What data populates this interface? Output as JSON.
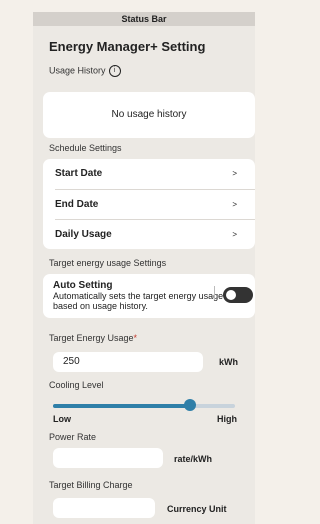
{
  "status_bar": "Status Bar",
  "title": "Energy Manager+ Setting",
  "usage_history": {
    "label": "Usage History",
    "empty_text": "No usage history"
  },
  "schedule": {
    "label": "Schedule Settings",
    "rows": [
      {
        "label": "Start Date",
        "chevron": ">"
      },
      {
        "label": "End Date",
        "chevron": ">"
      },
      {
        "label": "Daily Usage",
        "chevron": ">"
      }
    ]
  },
  "target_settings": {
    "label": "Target energy usage Settings",
    "auto_title": "Auto Setting",
    "auto_desc": "Automatically sets the target energy usage based on usage history.",
    "toggle_on": false
  },
  "target_energy": {
    "label": "Target Energy Usage",
    "required_mark": "*",
    "value": "250",
    "unit": "kWh"
  },
  "cooling": {
    "label": "Cooling Level",
    "low": "Low",
    "high": "High",
    "level": 0.75
  },
  "power_rate": {
    "label": "Power Rate",
    "value": "",
    "unit": "rate/kWh"
  },
  "billing": {
    "label": "Target Billing Charge",
    "value": "",
    "unit": "Currency Unit"
  },
  "colors": {
    "accent": "#2f7fa8",
    "required": "#c0392b",
    "background": "#ece9e4"
  }
}
